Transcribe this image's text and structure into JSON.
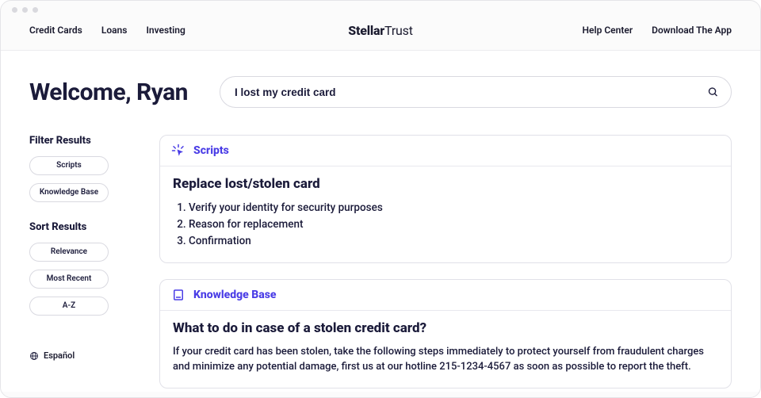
{
  "brand": {
    "bold": "Stellar",
    "light": "Trust"
  },
  "nav": {
    "left": [
      "Credit Cards",
      "Loans",
      "Investing"
    ],
    "right": [
      "Help Center",
      "Download The App"
    ]
  },
  "welcome": "Welcome, Ryan",
  "search": {
    "value": "I lost my credit card"
  },
  "sidebar": {
    "filter_heading": "Filter Results",
    "filters": [
      "Scripts",
      "Knowledge Base"
    ],
    "sort_heading": "Sort Results",
    "sorts": [
      "Relevance",
      "Most Recent",
      "A-Z"
    ],
    "language": "Español"
  },
  "scripts_card": {
    "label": "Scripts",
    "title": "Replace lost/stolen card",
    "steps": [
      "Verify your identity for security purposes",
      "Reason for replacement",
      "Confirmation"
    ]
  },
  "kb_card": {
    "label": "Knowledge Base",
    "title": "What to do in case of a stolen credit card?",
    "body": "If your credit card has been stolen, take the following steps immediately to protect yourself from fraudulent charges and minimize any potential damage, first us at our hotline 215-1234-4567 as soon as possible to report the theft."
  }
}
